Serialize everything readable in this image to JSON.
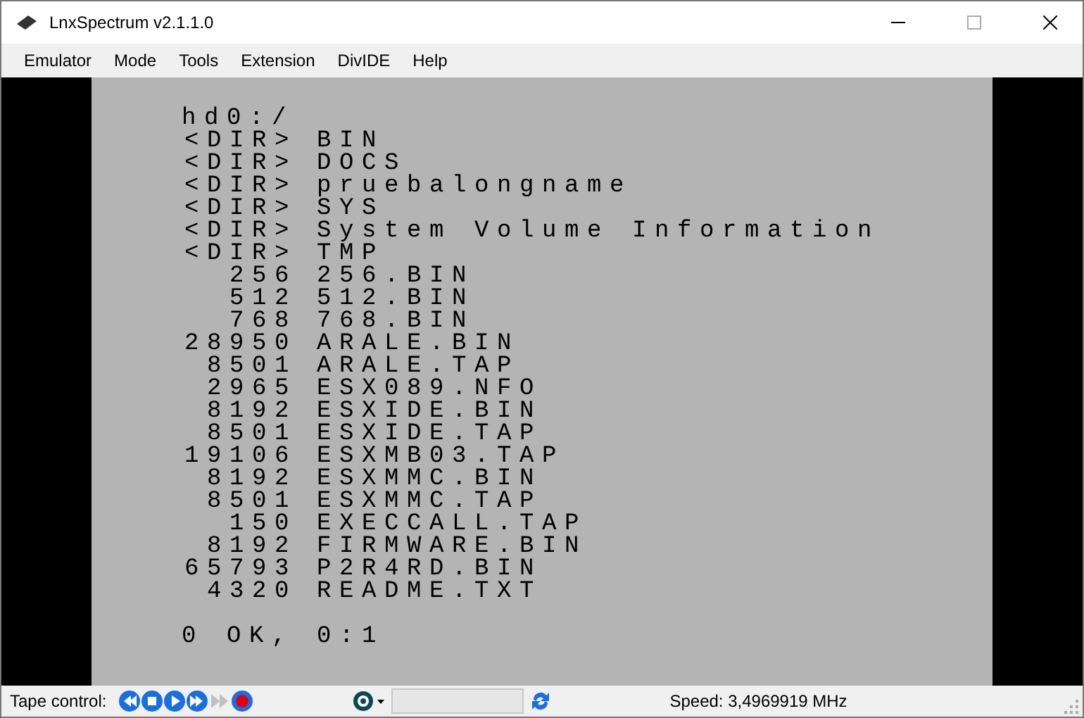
{
  "window": {
    "title": "LnxSpectrum v2.1.1.0"
  },
  "menu": [
    "Emulator",
    "Mode",
    "Tools",
    "Extension",
    "DivIDE",
    "Help"
  ],
  "screen": {
    "path": "hd0:/",
    "entries": [
      {
        "size": "<DIR>",
        "name": "BIN"
      },
      {
        "size": "<DIR>",
        "name": "DOCS"
      },
      {
        "size": "<DIR>",
        "name": "pruebalongname"
      },
      {
        "size": "<DIR>",
        "name": "SYS"
      },
      {
        "size": "<DIR>",
        "name": "System Volume Information"
      },
      {
        "size": "<DIR>",
        "name": "TMP"
      },
      {
        "size": "256",
        "name": "256.BIN"
      },
      {
        "size": "512",
        "name": "512.BIN"
      },
      {
        "size": "768",
        "name": "768.BIN"
      },
      {
        "size": "28950",
        "name": "ARALE.BIN"
      },
      {
        "size": "8501",
        "name": "ARALE.TAP"
      },
      {
        "size": "2965",
        "name": "ESX089.NFO"
      },
      {
        "size": "8192",
        "name": "ESXIDE.BIN"
      },
      {
        "size": "8501",
        "name": "ESXIDE.TAP"
      },
      {
        "size": "19106",
        "name": "ESXMB03.TAP"
      },
      {
        "size": "8192",
        "name": "ESXMMC.BIN"
      },
      {
        "size": "8501",
        "name": "ESXMMC.TAP"
      },
      {
        "size": "150",
        "name": "EXECCALL.TAP"
      },
      {
        "size": "8192",
        "name": "FIRMWARE.BIN"
      },
      {
        "size": "65793",
        "name": "P2R4RD.BIN"
      },
      {
        "size": "4320",
        "name": "README.TXT"
      }
    ],
    "status": "0 OK, 0:1"
  },
  "status_bar": {
    "tape_label": "Tape control:",
    "tape_buttons": [
      {
        "kind": "rewind",
        "disabled": false
      },
      {
        "kind": "stop",
        "disabled": false
      },
      {
        "kind": "play",
        "disabled": false
      },
      {
        "kind": "forward",
        "disabled": false
      },
      {
        "kind": "skip",
        "disabled": true
      },
      {
        "kind": "record",
        "disabled": false
      }
    ],
    "speed": "Speed: 3,4969919 MHz"
  }
}
